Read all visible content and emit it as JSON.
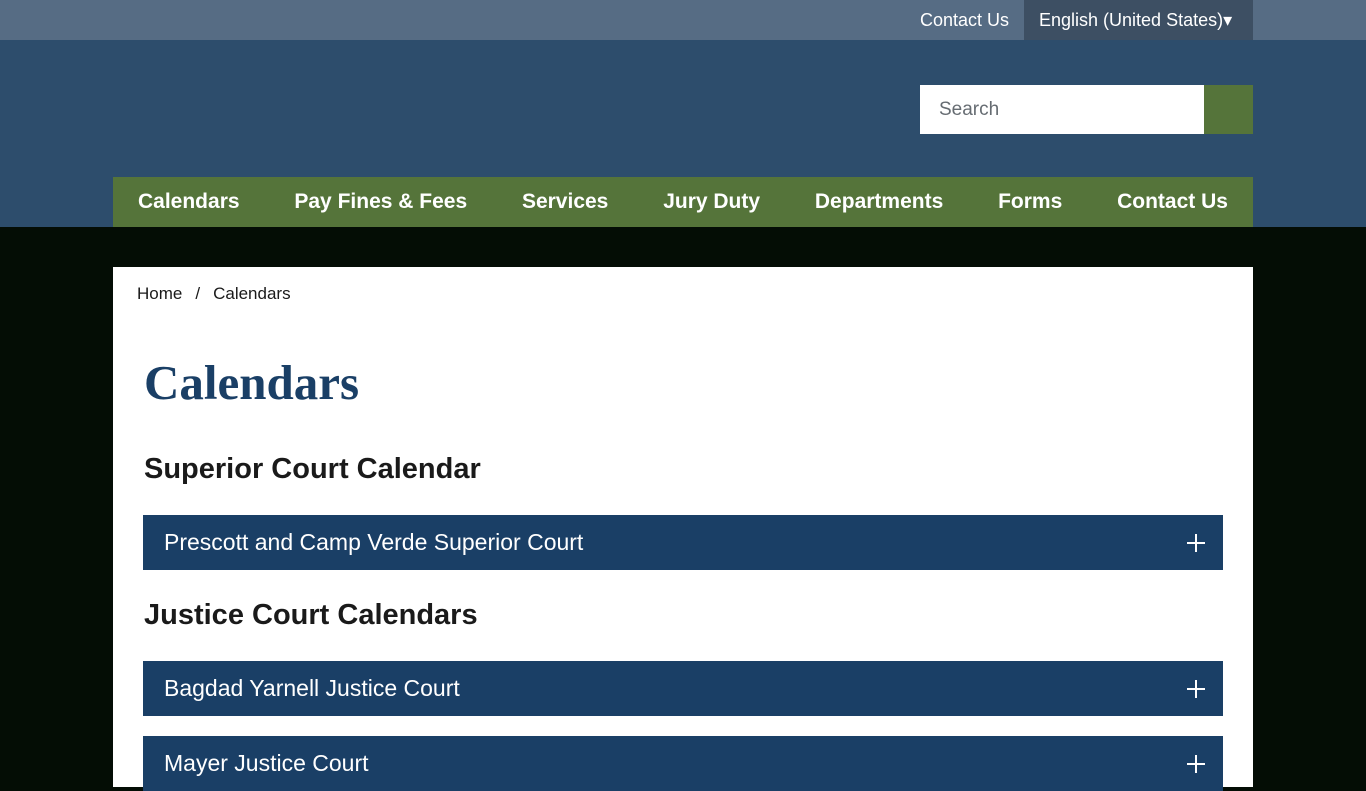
{
  "utility_bar": {
    "contact_label": "Contact Us",
    "language_label": "English (United States)▾"
  },
  "header": {
    "search": {
      "placeholder": "Search",
      "value": ""
    }
  },
  "nav": {
    "items": [
      {
        "label": "Calendars"
      },
      {
        "label": "Pay Fines & Fees"
      },
      {
        "label": "Services"
      },
      {
        "label": "Jury Duty"
      },
      {
        "label": "Departments"
      },
      {
        "label": "Forms"
      },
      {
        "label": "Contact Us"
      }
    ]
  },
  "breadcrumb": {
    "home": "Home",
    "separator": "/",
    "current": "Calendars"
  },
  "page": {
    "title": "Calendars",
    "sections": [
      {
        "heading": "Superior Court Calendar",
        "accordions": [
          {
            "label": "Prescott and Camp Verde Superior Court"
          }
        ]
      },
      {
        "heading": "Justice Court Calendars",
        "accordions": [
          {
            "label": "Bagdad Yarnell Justice Court"
          },
          {
            "label": "Mayer Justice Court"
          }
        ]
      }
    ]
  },
  "colors": {
    "utility_bar": "#566c84",
    "header": "#2d4d6c",
    "nav_green": "#55743a",
    "accordion_blue": "#1a3f66",
    "page_background": "#040d05"
  },
  "icons": {
    "accordion_toggle": "plus-icon",
    "search_submit": "search-icon"
  }
}
